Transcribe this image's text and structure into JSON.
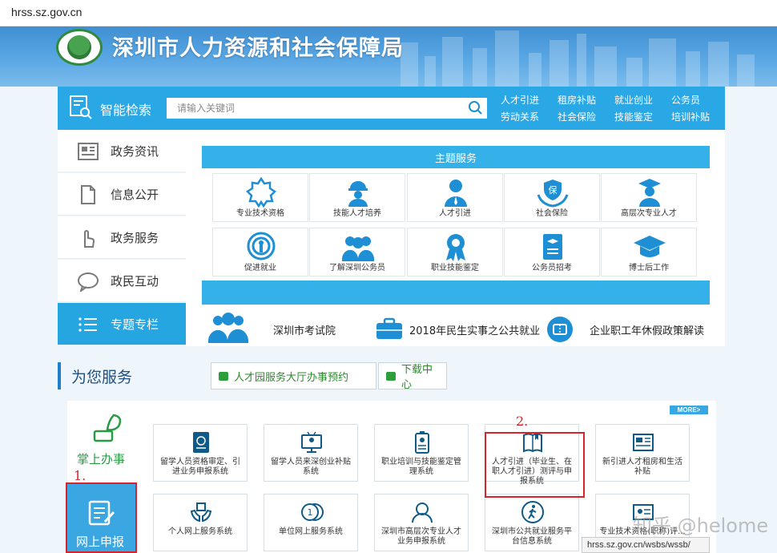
{
  "browser": {
    "url": "hrss.sz.gov.cn"
  },
  "header": {
    "title": "深圳市人力资源和社会保障局"
  },
  "search": {
    "label": "智能检索",
    "placeholder": "请输入关键词",
    "quick_links": [
      "人才引进",
      "租房补贴",
      "就业创业",
      "公务员",
      "劳动关系",
      "社会保险",
      "技能鉴定",
      "培训补贴"
    ]
  },
  "left_nav": [
    {
      "label": "政务资讯",
      "icon": "newspaper-icon"
    },
    {
      "label": "信息公开",
      "icon": "document-icon"
    },
    {
      "label": "政务服务",
      "icon": "hand-pointer-icon"
    },
    {
      "label": "政民互动",
      "icon": "chat-bubble-icon"
    },
    {
      "label": "专题专栏",
      "icon": "list-icon",
      "active": true
    }
  ],
  "theme_services": {
    "title": "主题服务",
    "items": [
      {
        "label": "专业技术资格",
        "icon": "badge-icon"
      },
      {
        "label": "技能人才培养",
        "icon": "worker-icon"
      },
      {
        "label": "人才引进",
        "icon": "person-icon"
      },
      {
        "label": "社会保险",
        "icon": "insurance-icon"
      },
      {
        "label": "高层次专业人才",
        "icon": "graduate-icon"
      },
      {
        "label": "促进就业",
        "icon": "broadcast-icon"
      },
      {
        "label": "了解深圳公务员",
        "icon": "group-icon"
      },
      {
        "label": "职业技能鉴定",
        "icon": "medal-icon"
      },
      {
        "label": "公务员招考",
        "icon": "exam-icon"
      },
      {
        "label": "博士后工作",
        "icon": "mortarboard-icon"
      }
    ]
  },
  "features": [
    {
      "label": "深圳市考试院",
      "icon": "group-icon"
    },
    {
      "label": "2018年民生实事之公共就业",
      "icon": "briefcase-icon"
    },
    {
      "label": "企业职工年休假政策解读",
      "icon": "ticket-icon"
    }
  ],
  "for_you": {
    "title": "为您服务",
    "buttons": [
      "人才园服务大厅办事预约",
      "下载中心"
    ],
    "more": "MORE>",
    "side": [
      "掌上办事",
      "网上申报"
    ],
    "services": [
      {
        "label": "留学人员资格审定、引进业务申报系统",
        "icon": "passport-icon"
      },
      {
        "label": "留学人员来深创业补贴系统",
        "icon": "monitor-icon"
      },
      {
        "label": "职业培训与技能鉴定管理系统",
        "icon": "id-card-icon"
      },
      {
        "label": "人才引进（毕业生、在职人才引进）测评与申报系统",
        "icon": "book-icon"
      },
      {
        "label": "新引进人才租房和生活补贴",
        "icon": "newspaper-icon"
      },
      {
        "label": "个人网上服务系统",
        "icon": "hands-icon"
      },
      {
        "label": "单位网上服务系统",
        "icon": "coins-icon"
      },
      {
        "label": "深圳市高层次专业人才业务申报系统",
        "icon": "profile-icon"
      },
      {
        "label": "深圳市公共就业服务平台信息系统",
        "icon": "walking-icon"
      },
      {
        "label": "专业技术资格(职称)评...",
        "icon": "certificate-icon"
      }
    ]
  },
  "annotations": {
    "one": "1.",
    "two": "2."
  },
  "watermark": "知乎 @helome",
  "status_url": "hrss.sz.gov.cn/wsbs/wssb/"
}
